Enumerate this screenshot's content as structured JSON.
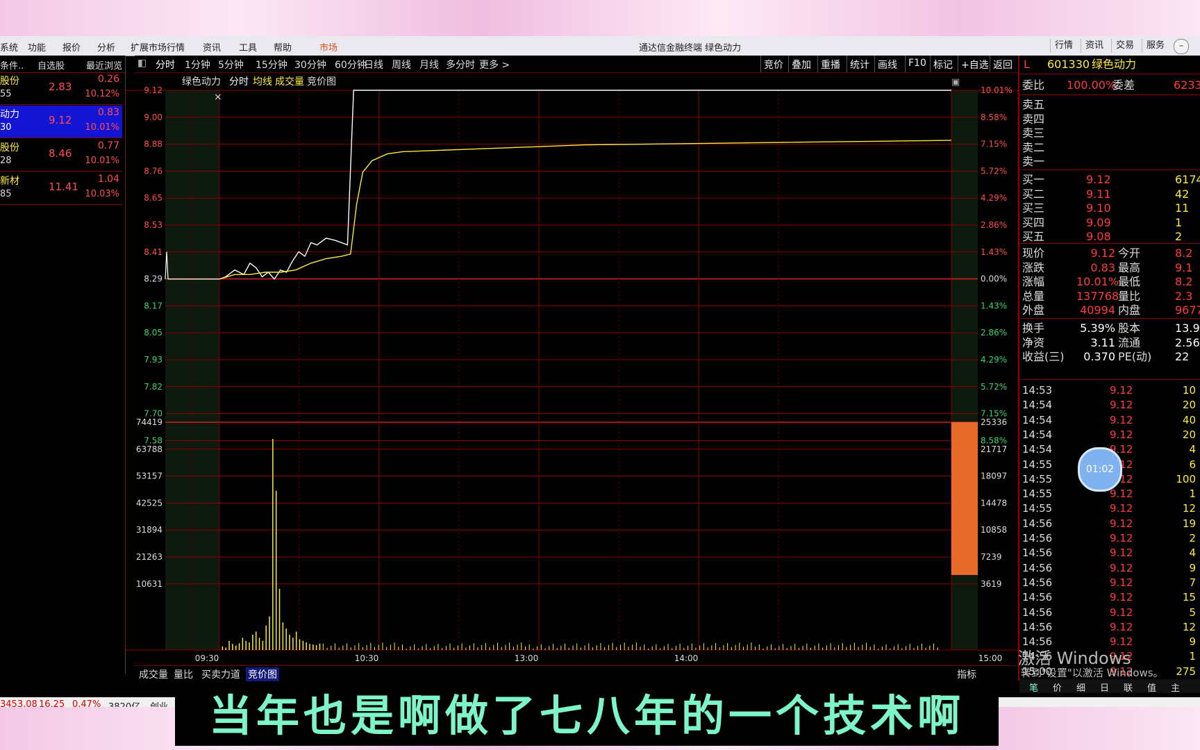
{
  "window": {
    "title": "通达信金融终端  绿色动力"
  },
  "menu": {
    "items": [
      "系统",
      "功能",
      "报价",
      "分析",
      "扩展市场行情",
      "资讯",
      "工具",
      "帮助"
    ],
    "market_tab": "市场",
    "right_buttons": [
      "行情",
      "资讯",
      "交易",
      "服务"
    ]
  },
  "left_panel": {
    "tabs": [
      "条件..",
      "自选股",
      "最近浏览"
    ],
    "rows": [
      {
        "name1": "股份",
        "name2": "55",
        "price": "2.83",
        "change": "0.26",
        "pct": "10.12%",
        "selected": false
      },
      {
        "name1": "动力",
        "name2": "30",
        "price": "9.12",
        "change": "0.83",
        "pct": "10.01%",
        "selected": true
      },
      {
        "name1": "股份",
        "name2": "28",
        "price": "8.46",
        "change": "0.77",
        "pct": "10.01%",
        "selected": false
      },
      {
        "name1": "新材",
        "name2": "85",
        "price": "11.41",
        "change": "1.04",
        "pct": "10.03%",
        "selected": false
      }
    ]
  },
  "chart_toolbar": {
    "periods": [
      "分时",
      "1分钟",
      "5分钟",
      "15分钟",
      "30分钟",
      "60分钟",
      "日线",
      "周线",
      "月线",
      "多分时",
      "更多 >"
    ],
    "right_tools": [
      "竞价",
      "叠加",
      "重播",
      "统计",
      "画线",
      "F10",
      "标记",
      "+自选",
      "返回"
    ]
  },
  "chart_header": {
    "stock": "绿色动力",
    "mode": "分时",
    "avg": "均线",
    "vol": "成交量",
    "auction": "竞价图"
  },
  "bottom_tabs": [
    "成交量",
    "量比",
    "买卖力道",
    "竞价图"
  ],
  "bottom_tabs_active": 3,
  "bottom_right": "指标",
  "chart_data": {
    "type": "line",
    "title": "绿色动力 分时",
    "x_ticks": [
      "09:30",
      "10:30",
      "13:00",
      "14:00",
      "15:00"
    ],
    "price_ticks": [
      "9.12",
      "9.00",
      "8.88",
      "8.76",
      "8.65",
      "8.53",
      "8.41",
      "8.29",
      "8.17",
      "8.05",
      "7.93",
      "7.82",
      "7.70",
      "7.58"
    ],
    "pct_ticks": [
      "10.01%",
      "8.58%",
      "7.15%",
      "5.72%",
      "4.29%",
      "2.86%",
      "1.43%",
      "0.00%",
      "1.43%",
      "2.86%",
      "4.29%",
      "5.72%",
      "7.15%",
      "8.58%"
    ],
    "volume_ticks_left": [
      "74419",
      "63788",
      "53157",
      "42525",
      "31894",
      "21263",
      "10631"
    ],
    "volume_ticks_right": [
      "25336",
      "21717",
      "18097",
      "14478",
      "10858",
      "7239",
      "3619"
    ],
    "prev_close": 8.29,
    "series": [
      {
        "name": "price",
        "color": "#ffffff",
        "x": [
          0,
          2,
          5,
          8,
          10,
          12,
          14,
          16,
          18,
          20,
          22,
          24,
          26,
          28,
          30,
          32,
          35,
          38,
          40,
          42,
          44,
          46,
          48,
          50,
          52,
          55,
          58,
          62,
          70,
          100,
          150,
          240
        ],
        "y": [
          8.29,
          8.3,
          8.33,
          8.31,
          8.36,
          8.34,
          8.3,
          8.32,
          8.29,
          8.33,
          8.32,
          8.37,
          8.41,
          8.39,
          8.45,
          8.44,
          8.47,
          8.46,
          8.45,
          8.44,
          9.12,
          9.12,
          9.12,
          9.12,
          9.12,
          9.12,
          9.12,
          9.12,
          9.12,
          9.12,
          9.12,
          9.12
        ]
      },
      {
        "name": "均线",
        "color": "#ffeb3b",
        "x": [
          0,
          5,
          10,
          15,
          20,
          25,
          30,
          35,
          40,
          43,
          45,
          47,
          50,
          55,
          60,
          80,
          120,
          180,
          240
        ],
        "y": [
          8.29,
          8.31,
          8.31,
          8.32,
          8.32,
          8.33,
          8.36,
          8.38,
          8.39,
          8.4,
          8.62,
          8.76,
          8.81,
          8.84,
          8.85,
          8.86,
          8.88,
          8.89,
          8.9
        ]
      }
    ],
    "volume": [
      1200,
      800,
      3000,
      2000,
      1500,
      2200,
      4000,
      3000,
      2500,
      5000,
      6000,
      4000,
      3000,
      8000,
      11000,
      69000,
      52000,
      20000,
      9000,
      7000,
      5000,
      4000,
      6000,
      3500,
      3000,
      2500,
      2000,
      1800,
      1600,
      2100
    ]
  },
  "right_panel": {
    "code": "601330",
    "name": "绿色动力",
    "prefix": "L",
    "ratio_label": "委比",
    "ratio": "100.00%",
    "diff_label": "委差",
    "diff": "6233",
    "asks": [
      {
        "label": "卖五"
      },
      {
        "label": "卖四"
      },
      {
        "label": "卖三"
      },
      {
        "label": "卖二"
      },
      {
        "label": "卖一"
      }
    ],
    "bids": [
      {
        "label": "买一",
        "price": "9.12",
        "vol": "6174"
      },
      {
        "label": "买二",
        "price": "9.11",
        "vol": "42"
      },
      {
        "label": "买三",
        "price": "9.10",
        "vol": "11"
      },
      {
        "label": "买四",
        "price": "9.09",
        "vol": "1"
      },
      {
        "label": "买五",
        "price": "9.08",
        "vol": "2"
      }
    ],
    "stats": [
      {
        "l1": "现价",
        "v1": "9.12",
        "l2": "今开",
        "v2": "8.2"
      },
      {
        "l1": "涨跌",
        "v1": "0.83",
        "l2": "最高",
        "v2": "9.1"
      },
      {
        "l1": "涨幅",
        "v1": "10.01%",
        "l2": "最低",
        "v2": "8.2"
      },
      {
        "l1": "总量",
        "v1": "137768",
        "l2": "量比",
        "v2": "2.3"
      },
      {
        "l1": "外盘",
        "v1": "40994",
        "l2": "内盘",
        "v2": "9677"
      }
    ],
    "stats2": [
      {
        "l1": "换手",
        "v1": "5.39%",
        "l2": "股本",
        "v2": "13.9"
      },
      {
        "l1": "净资",
        "v1": "3.11",
        "l2": "流通",
        "v2": "2.56"
      },
      {
        "l1": "收益(三)",
        "v1": "0.370",
        "l2": "PE(动)",
        "v2": "22"
      }
    ],
    "ticks": [
      {
        "t": "14:53",
        "p": "9.12",
        "v": "10"
      },
      {
        "t": "14:54",
        "p": "9.12",
        "v": "20"
      },
      {
        "t": "14:54",
        "p": "9.12",
        "v": "40"
      },
      {
        "t": "14:54",
        "p": "9.12",
        "v": "20"
      },
      {
        "t": "14:54",
        "p": "9.12",
        "v": "4"
      },
      {
        "t": "14:55",
        "p": "9.12",
        "v": "6"
      },
      {
        "t": "14:55",
        "p": "9.12",
        "v": "100"
      },
      {
        "t": "14:55",
        "p": "9.12",
        "v": "1"
      },
      {
        "t": "14:55",
        "p": "9.12",
        "v": "12"
      },
      {
        "t": "14:56",
        "p": "9.12",
        "v": "19"
      },
      {
        "t": "14:56",
        "p": "9.12",
        "v": "2"
      },
      {
        "t": "14:56",
        "p": "9.12",
        "v": "4"
      },
      {
        "t": "14:56",
        "p": "9.12",
        "v": "9"
      },
      {
        "t": "14:56",
        "p": "9.12",
        "v": "7"
      },
      {
        "t": "14:56",
        "p": "9.12",
        "v": "15"
      },
      {
        "t": "14:56",
        "p": "9.12",
        "v": "5"
      },
      {
        "t": "14:56",
        "p": "9.12",
        "v": "12"
      },
      {
        "t": "14:56",
        "p": "9.12",
        "v": "9"
      },
      {
        "t": "14:56",
        "p": "9.12",
        "v": "1"
      },
      {
        "t": "15:00",
        "p": "9.12",
        "v": "275"
      }
    ],
    "bottom_tabs": [
      "笔",
      "价",
      "细",
      "日",
      "联",
      "值",
      "主"
    ]
  },
  "status_bar": {
    "index": "3453.08",
    "change": "16.25",
    "pct": "0.47%",
    "amount": "3820亿",
    "board": "创业"
  },
  "subtitle": "当年也是啊做了七八年的一个技术啊",
  "timer": "01:02",
  "watermark": {
    "line1": "激活 Windows",
    "line2": "转到\"设置\"以激活 Windows。"
  }
}
